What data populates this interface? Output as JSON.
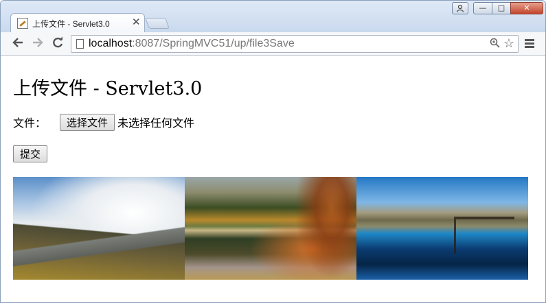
{
  "browser": {
    "tab_title": "上传文件 - Servlet3.0",
    "tab_close": "✕",
    "url_host": "localhost",
    "url_rest": ":8087/SpringMVC51/up/file3Save"
  },
  "window_controls": {
    "minimize": "—",
    "maximize": "□",
    "close": "✕"
  },
  "page": {
    "title": "上传文件 - Servlet3.0",
    "file_label": "文件：",
    "file_button": "选择文件",
    "file_status": "未选择任何文件",
    "submit_button": "提交"
  },
  "icons": {
    "back": "back-arrow-icon",
    "forward": "forward-arrow-icon",
    "reload": "reload-icon",
    "zoom": "zoom-icon",
    "bookmark": "star-icon",
    "menu": "menu-icon"
  }
}
